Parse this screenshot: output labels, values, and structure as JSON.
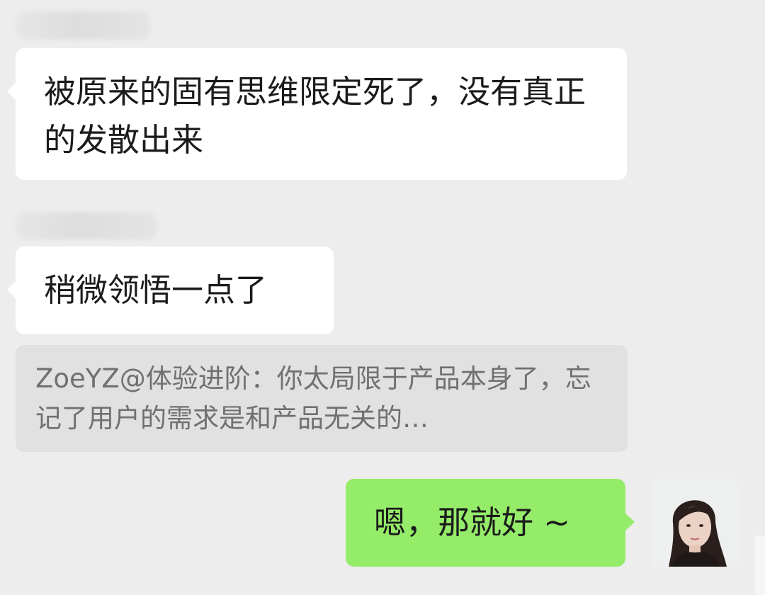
{
  "messages": [
    {
      "text": "被原来的固有思维限定死了，没有真正的发散出来"
    },
    {
      "text": "稍微领悟一点了"
    },
    {
      "quote": "ZoeYZ@体验进阶：你太局限于产品本身了，忘记了用户的需求是和产品无关的…"
    },
    {
      "text": "嗯，那就好 ~"
    }
  ],
  "colors": {
    "chat_background": "#ededed",
    "incoming_bubble": "#ffffff",
    "outgoing_bubble": "#95ec69",
    "quote_background": "#e1e1e1"
  },
  "icons": [
    "user-avatar"
  ]
}
